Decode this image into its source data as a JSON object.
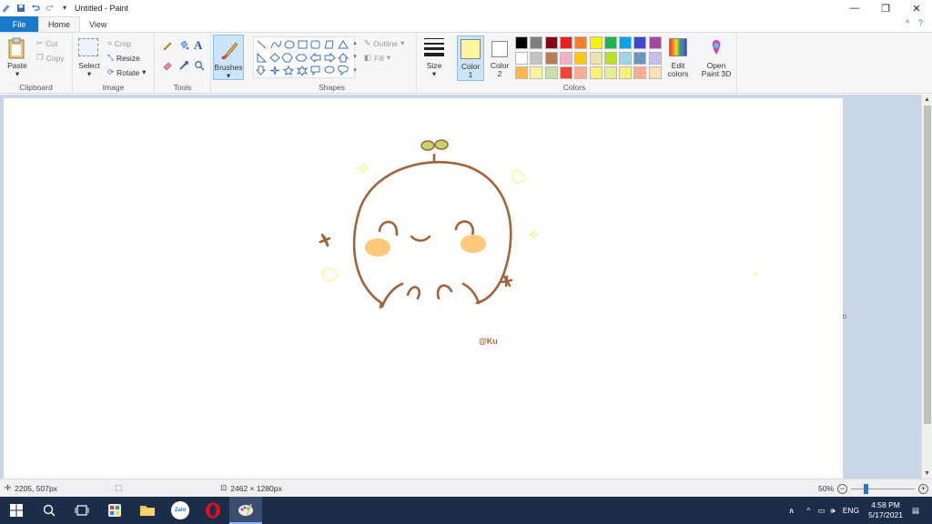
{
  "window": {
    "title": "Untitled - Paint",
    "minimize": "—",
    "restore": "❐",
    "close": "✕"
  },
  "tabs": [
    {
      "label": "File"
    },
    {
      "label": "Home"
    },
    {
      "label": "View"
    }
  ],
  "ribbon": {
    "clipboard": {
      "paste": "Paste",
      "cut": "Cut",
      "copy": "Copy",
      "label": "Clipboard"
    },
    "image": {
      "select": "Select",
      "crop": "Crop",
      "resize": "Resize",
      "rotate": "Rotate",
      "label": "Image"
    },
    "tools": {
      "label": "Tools"
    },
    "brushes": {
      "label": "Brushes"
    },
    "shapes": {
      "outline": "Outline",
      "fill": "Fill",
      "label": "Shapes"
    },
    "size": {
      "label": "Size"
    },
    "color1": {
      "label": "Color",
      "num": "1",
      "value": "#fff59d"
    },
    "color2": {
      "label": "Color",
      "num": "2",
      "value": "#ffffff"
    },
    "colors": {
      "label": "Colors",
      "edit": "Edit",
      "edit2": "colors"
    },
    "paint3d": {
      "label": "Open",
      "label2": "Paint 3D"
    }
  },
  "palette": {
    "row1": [
      "#000000",
      "#7f7f7f",
      "#880015",
      "#ed1c24",
      "#ff7f27",
      "#fff200",
      "#22b14c",
      "#00a2e8",
      "#3f48cc",
      "#a349a4"
    ],
    "row2": [
      "#ffffff",
      "#c3c3c3",
      "#b97a57",
      "#ffaec9",
      "#ffc90e",
      "#efe4b0",
      "#b5e61d",
      "#99d9ea",
      "#7092be",
      "#c8bfe7"
    ],
    "row3": [
      "#ffb74d",
      "#fff59d",
      "#c5e1a5",
      "#f44336",
      "#ffab91",
      "#fff176",
      "#e6ee9c",
      "#fff176",
      "#ffab91",
      "#ffe0b2"
    ]
  },
  "drawing": {
    "signature": "@Ku",
    "stroke": "#a0643c",
    "blush": "#ffc87a",
    "sprout": "#c8d46a",
    "sparkle": "#fff3a0"
  },
  "status": {
    "cursor": "2205, 507px",
    "size": "2462 × 1280px",
    "zoom": "50%"
  },
  "taskbar": {
    "time": "4:58 PM",
    "date": "5/17/2021",
    "lang": "ENG",
    "zalo": "Zalo"
  }
}
